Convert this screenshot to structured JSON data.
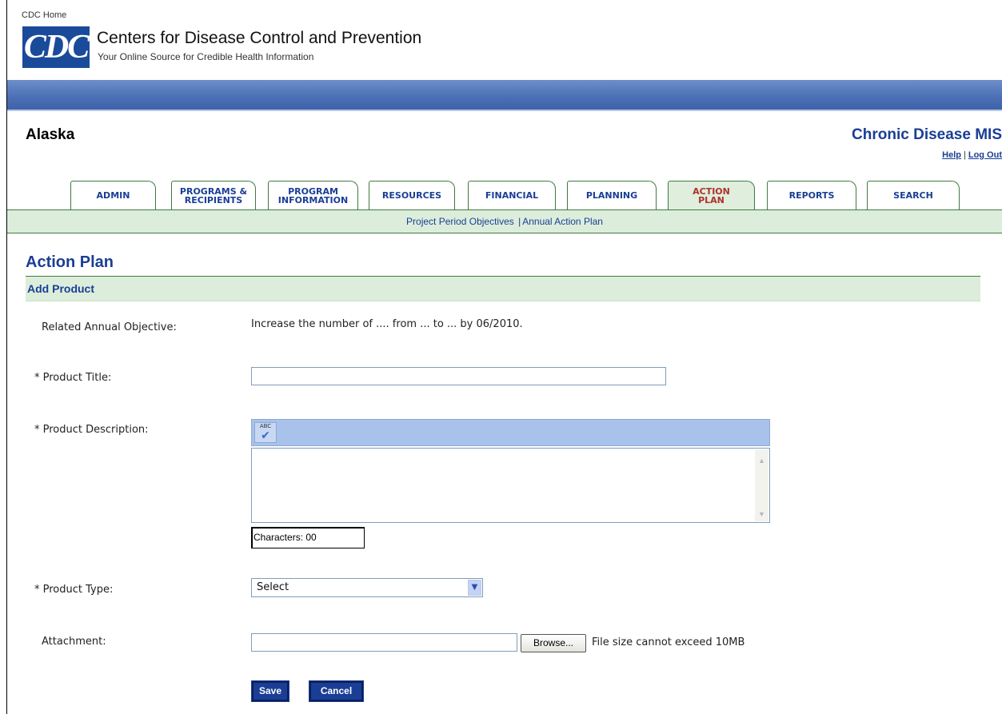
{
  "header": {
    "cdc_home": "CDC Home",
    "logo_text": "CDC",
    "org_name": "Centers for Disease Control and Prevention",
    "tagline": "Your Online Source for Credible Health Information",
    "brand_color": "#1a4a9a"
  },
  "app": {
    "state": "Alaska",
    "name": "Chronic Disease MIS",
    "help_link": "Help",
    "separator": "|",
    "logout_link": "Log Out"
  },
  "tabs": [
    {
      "line1": "ADMIN",
      "line2": "",
      "active": false
    },
    {
      "line1": "PROGRAMS &",
      "line2": "RECIPIENTS",
      "active": false
    },
    {
      "line1": "PROGRAM",
      "line2": "INFORMATION",
      "active": false
    },
    {
      "line1": "RESOURCES",
      "line2": "",
      "active": false
    },
    {
      "line1": "FINANCIAL",
      "line2": "",
      "active": false
    },
    {
      "line1": "PLANNING",
      "line2": "",
      "active": false
    },
    {
      "line1": "ACTION",
      "line2": "PLAN",
      "active": true
    },
    {
      "line1": "REPORTS",
      "line2": "",
      "active": false
    },
    {
      "line1": "SEARCH",
      "line2": "",
      "active": false
    }
  ],
  "subnav": {
    "link1": "Project Period Objectives ",
    "separator": "|",
    "link2": "Annual Action Plan"
  },
  "page": {
    "title": "Action Plan",
    "section": "Add Product"
  },
  "form": {
    "objective_label": "Related Annual Objective:",
    "objective_value": "Increase the number of .... from ... to ... by 06/2010.",
    "title_label": "* Product Title:",
    "title_value": "",
    "description_label": "* Product Description:",
    "spellcheck_icon_text": "ABC",
    "description_value": "",
    "char_count": "Characters: 00",
    "type_label": "* Product Type:",
    "type_selected": "Select",
    "attachment_label": "Attachment:",
    "attachment_value": "",
    "browse_label": "Browse...",
    "file_size_note": "File size cannot exceed 10MB",
    "save_label": "Save",
    "cancel_label": "Cancel"
  },
  "colors": {
    "nav_text": "#1a3e95",
    "active_tab_text": "#b0302a",
    "green_band": "#dceedb",
    "blue_bar": "#4a6fb4"
  }
}
